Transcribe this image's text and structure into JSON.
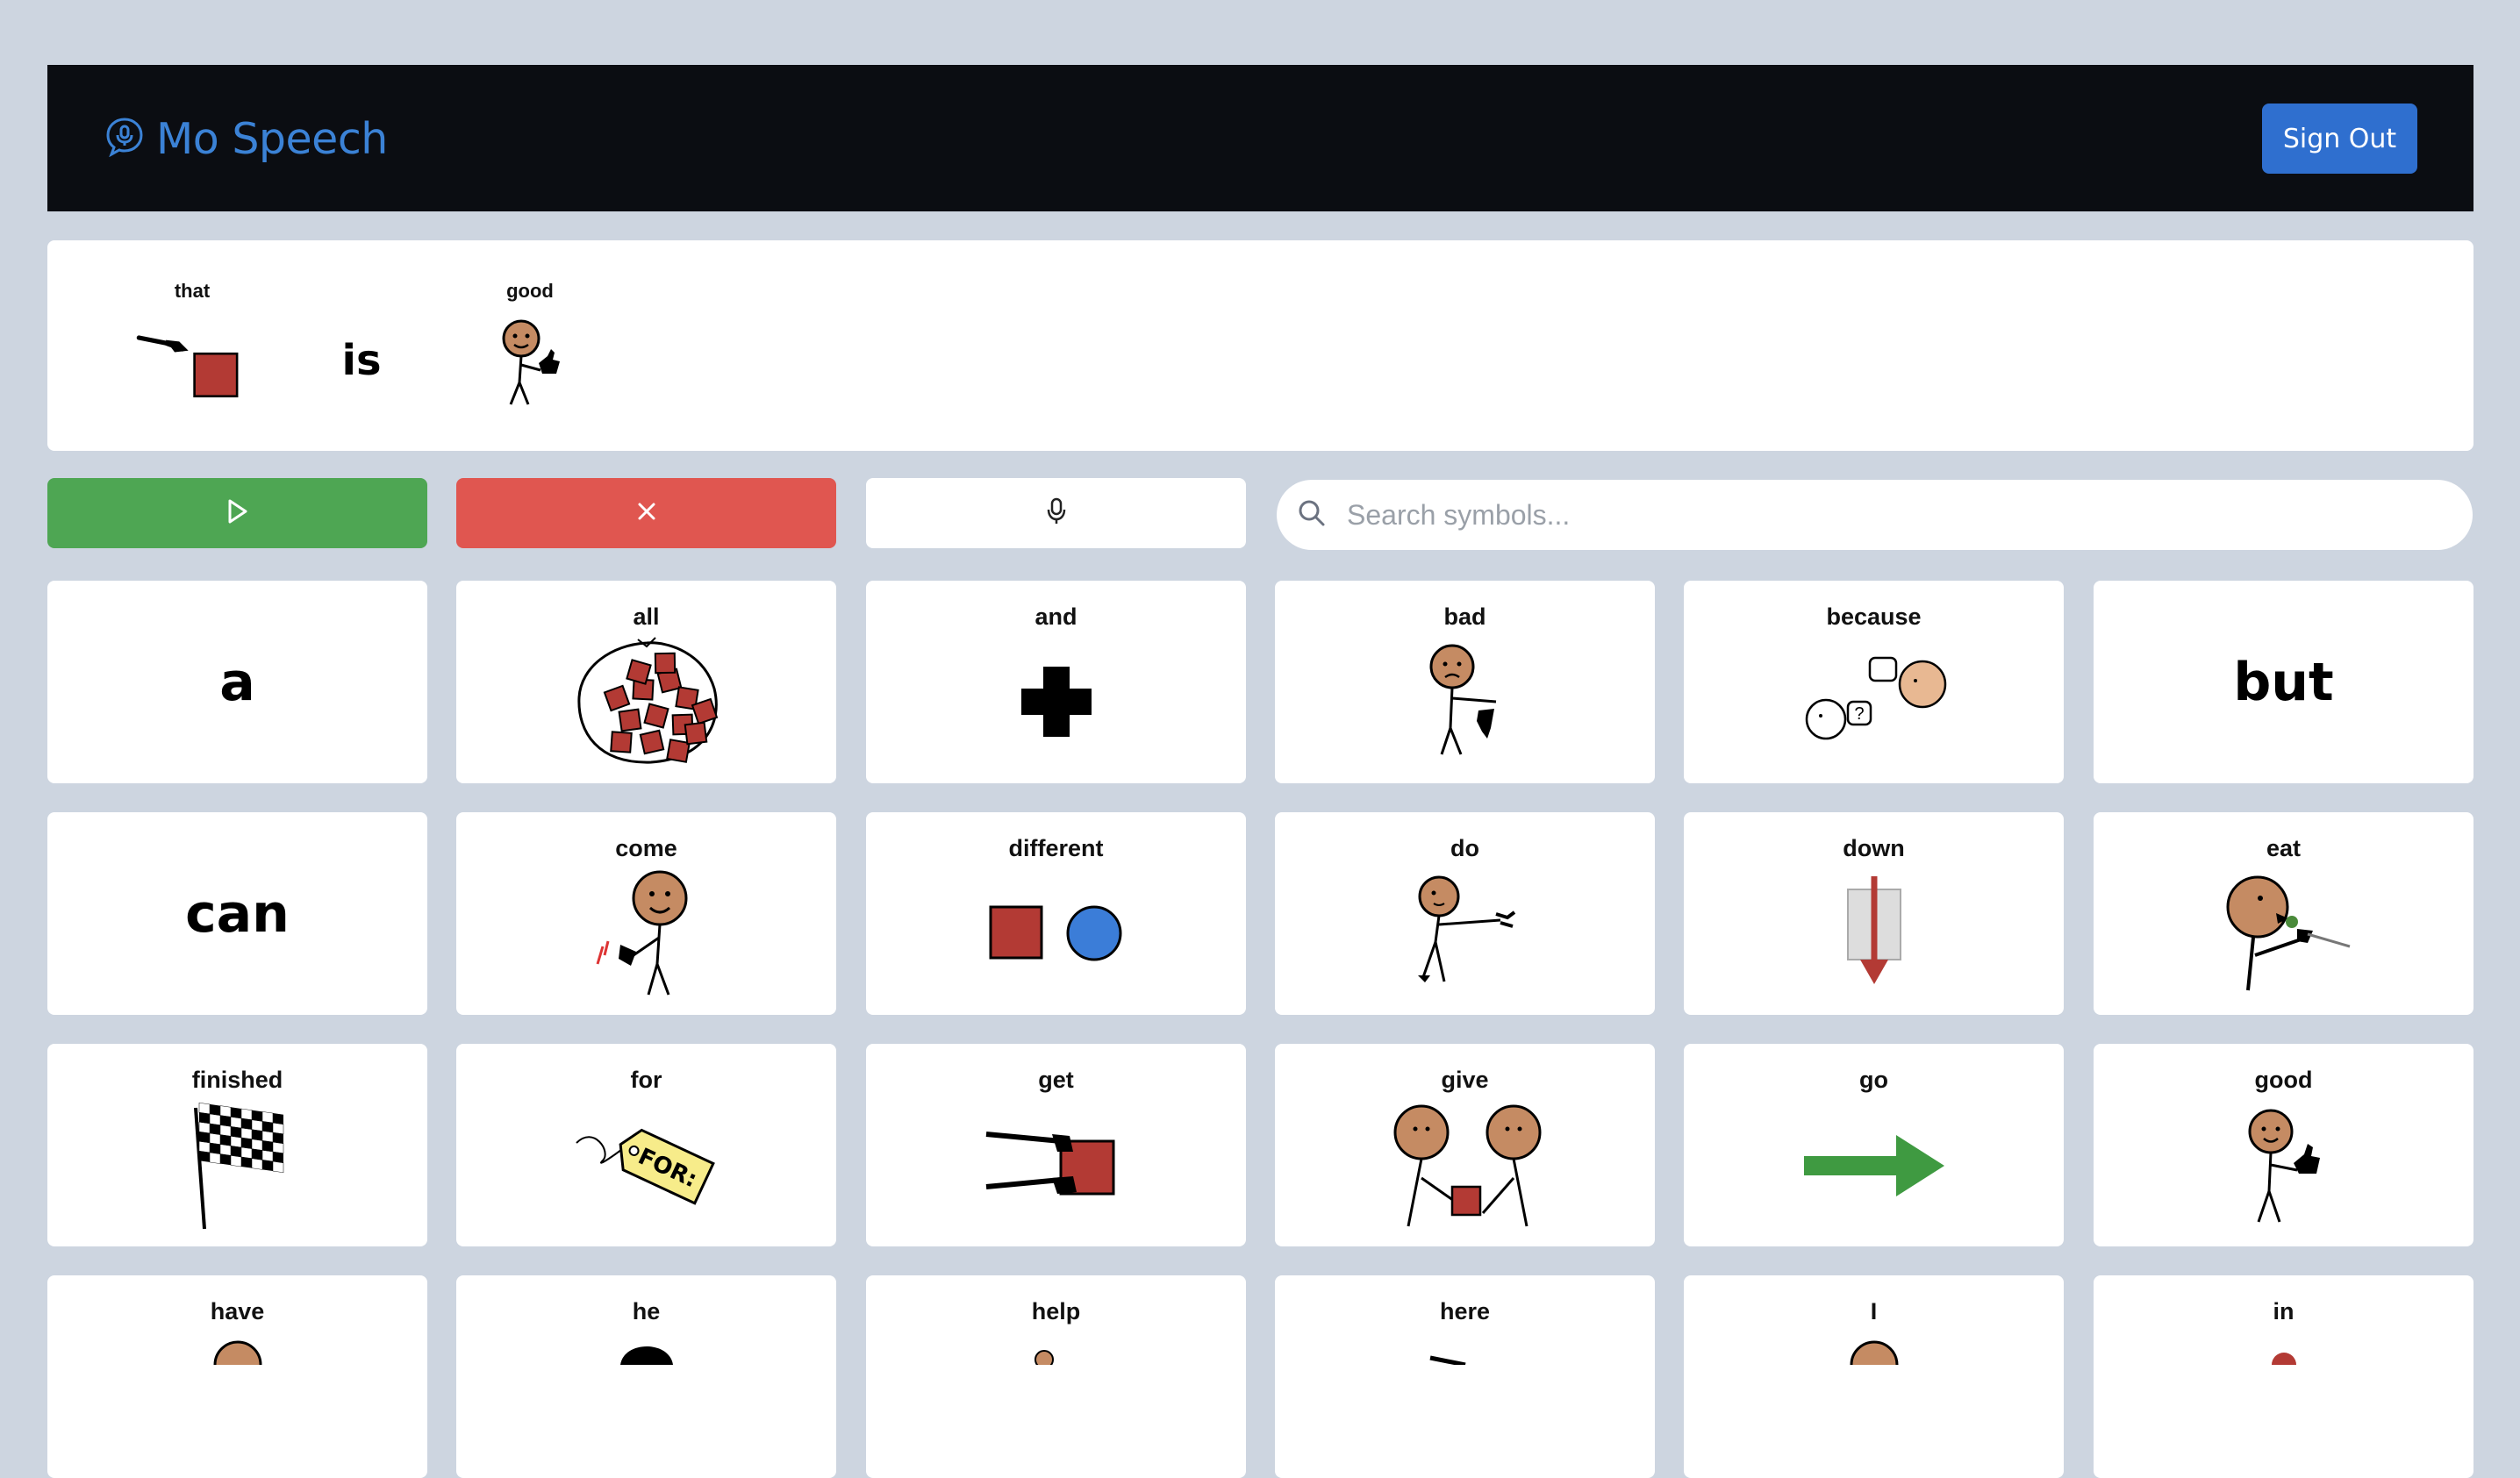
{
  "app": {
    "title": "Mo Speech",
    "sign_out_label": "Sign Out"
  },
  "sentence": [
    {
      "label": "that",
      "icon": "that-pointing-icon"
    },
    {
      "label": "",
      "word": "is"
    },
    {
      "label": "good",
      "icon": "good-thumbs-up-icon"
    }
  ],
  "controls": {
    "play_icon": "play-icon",
    "clear_icon": "close-icon",
    "mic_icon": "microphone-icon"
  },
  "search": {
    "placeholder": "Search symbols..."
  },
  "symbols": [
    {
      "label": "",
      "word": "a"
    },
    {
      "label": "all",
      "icon": "all-icon"
    },
    {
      "label": "and",
      "icon": "plus-icon"
    },
    {
      "label": "bad",
      "icon": "thumbs-down-person-icon"
    },
    {
      "label": "because",
      "icon": "because-icon"
    },
    {
      "label": "",
      "word": "but"
    },
    {
      "label": "",
      "word": "can"
    },
    {
      "label": "come",
      "icon": "come-beckon-icon"
    },
    {
      "label": "different",
      "icon": "different-shapes-icon"
    },
    {
      "label": "do",
      "icon": "do-person-icon"
    },
    {
      "label": "down",
      "icon": "down-arrow-icon"
    },
    {
      "label": "eat",
      "icon": "eat-person-icon"
    },
    {
      "label": "finished",
      "icon": "checkered-flag-icon"
    },
    {
      "label": "for",
      "icon": "for-tag-icon"
    },
    {
      "label": "get",
      "icon": "get-hand-icon"
    },
    {
      "label": "give",
      "icon": "give-people-icon"
    },
    {
      "label": "go",
      "icon": "right-arrow-icon"
    },
    {
      "label": "good",
      "icon": "good-thumbs-up-icon"
    },
    {
      "label": "have",
      "icon": "have-icon"
    },
    {
      "label": "he",
      "icon": "he-icon"
    },
    {
      "label": "help",
      "icon": "help-icon"
    },
    {
      "label": "here",
      "icon": "here-icon"
    },
    {
      "label": "I",
      "icon": "i-person-icon"
    },
    {
      "label": "in",
      "icon": "in-icon"
    }
  ],
  "colors": {
    "header_bg": "#0b0d12",
    "brand": "#3b82d6",
    "play": "#4ea653",
    "clear": "#e05650",
    "page_bg": "#cdd5e0"
  }
}
